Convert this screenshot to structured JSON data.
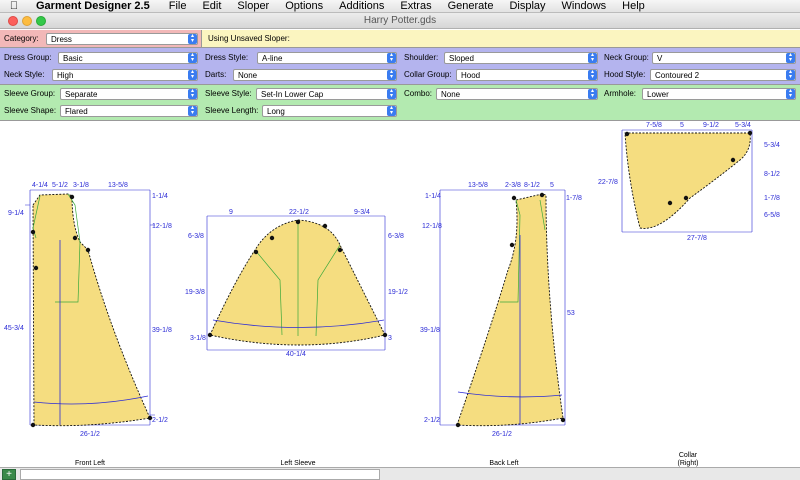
{
  "menubar": {
    "app": "Garment Designer 2.5",
    "items": [
      "File",
      "Edit",
      "Sloper",
      "Options",
      "Additions",
      "Extras",
      "Generate",
      "Display",
      "Windows",
      "Help"
    ]
  },
  "window": {
    "title": "Harry Potter.gds"
  },
  "category": {
    "label": "Category:",
    "value": "Dress",
    "sloper_text": "Using Unsaved Sloper:"
  },
  "style": {
    "dress_group": {
      "label": "Dress Group:",
      "value": "Basic"
    },
    "dress_style": {
      "label": "Dress Style:",
      "value": "A-line"
    },
    "shoulder": {
      "label": "Shoulder:",
      "value": "Sloped"
    },
    "neck_group": {
      "label": "Neck Group:",
      "value": "V"
    },
    "neck_style": {
      "label": "Neck Style:",
      "value": "High"
    },
    "darts": {
      "label": "Darts:",
      "value": "None"
    },
    "collar_group": {
      "label": "Collar Group:",
      "value": "Hood"
    },
    "hood_style": {
      "label": "Hood Style:",
      "value": "Contoured 2"
    }
  },
  "sleeve": {
    "sleeve_group": {
      "label": "Sleeve Group:",
      "value": "Separate"
    },
    "sleeve_style": {
      "label": "Sleeve Style:",
      "value": "Set-In Lower Cap"
    },
    "combo": {
      "label": "Combo:",
      "value": "None"
    },
    "armhole": {
      "label": "Armhole:",
      "value": "Lower"
    },
    "sleeve_shape": {
      "label": "Sleeve Shape:",
      "value": "Flared"
    },
    "sleeve_length": {
      "label": "Sleeve Length:",
      "value": "Long"
    }
  },
  "colors": {
    "pattern_fill": "#f5dd80",
    "dim_line": "#2b2bd6",
    "guide_line": "#3aa83a",
    "category_bar": "#f2b8b8",
    "sloper_bar": "#fbf5c0",
    "style_bar": "#b4b4ee",
    "sleeve_bar": "#b3eab0"
  },
  "pieces": {
    "front_left": {
      "name": "Front Left",
      "dims": {
        "t1": "4-1/4",
        "t2": "5-1/2",
        "t3": "3-1/8",
        "t4": "13-5/8",
        "l1": "9-1/4",
        "r1": "1-1/4",
        "r2": "12-1/8",
        "l2": "45-3/4",
        "r3": "39-1/8",
        "r4": "2-1/2",
        "bottom": "26-1/2"
      }
    },
    "left_sleeve": {
      "name": "Left Sleeve",
      "dims": {
        "t1": "9",
        "t2": "22-1/2",
        "t3": "9-3/4",
        "l1": "6-3/8",
        "r1": "6-3/8",
        "l2": "19-3/8",
        "r2": "19-1/2",
        "l3": "3-1/8",
        "r3": "3",
        "bottom": "40-1/4"
      }
    },
    "back_left": {
      "name": "Back Left",
      "dims": {
        "t1": "13-5/8",
        "t2": "2-3/8",
        "t3": "8-1/2",
        "t4": "5",
        "l1": "1-1/4",
        "r1": "1-7/8",
        "l2": "12-1/8",
        "l3": "39-1/8",
        "r2": "53",
        "l4": "2-1/2",
        "bottom": "26-1/2"
      }
    },
    "collar": {
      "name": "Collar",
      "name2": "(Right)",
      "dims": {
        "t1": "7-5/8",
        "t2": "5",
        "t3": "9-1/2",
        "t4": "5-3/4",
        "l1": "22-7/8",
        "r1": "5-3/4",
        "r2": "8-1/2",
        "r3": "1-7/8",
        "r4": "6-5/8",
        "bottom": "27-7/8"
      }
    }
  }
}
